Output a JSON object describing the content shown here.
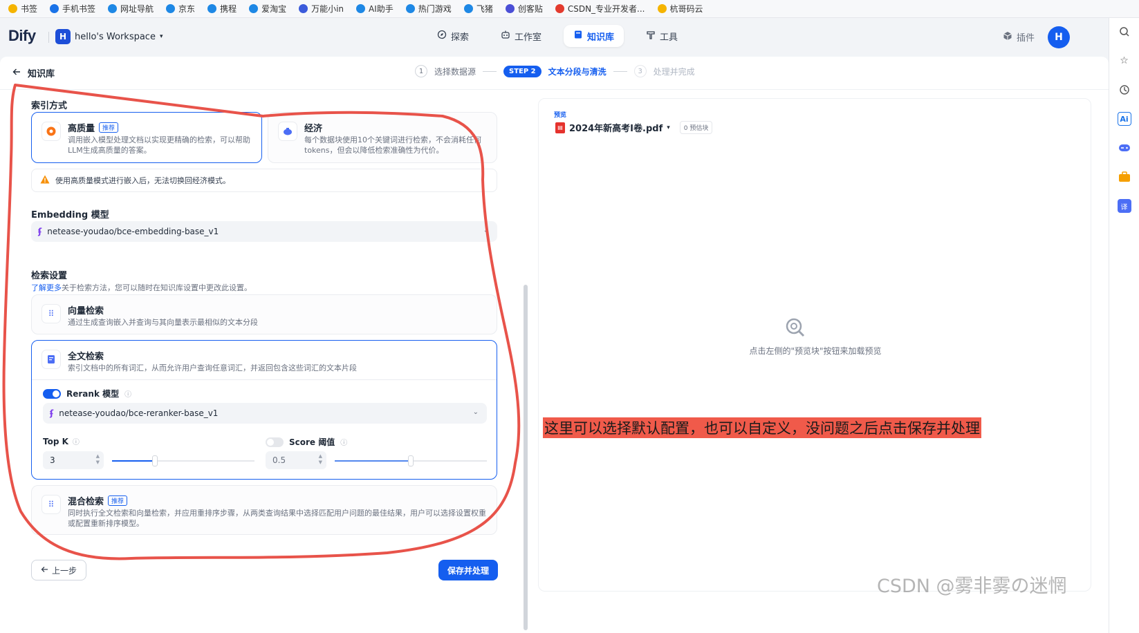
{
  "bookmarks": [
    {
      "label": "书签",
      "color": "#f5b400"
    },
    {
      "label": "手机书签",
      "color": "#1a73e8"
    },
    {
      "label": "网址导航",
      "color": "#1e88e5"
    },
    {
      "label": "京东",
      "color": "#1e88e5"
    },
    {
      "label": "携程",
      "color": "#1e88e5"
    },
    {
      "label": "爱淘宝",
      "color": "#1e88e5"
    },
    {
      "label": "万能小in",
      "color": "#3b5bdb"
    },
    {
      "label": "AI助手",
      "color": "#1e88e5"
    },
    {
      "label": "热门游戏",
      "color": "#1e88e5"
    },
    {
      "label": "飞猪",
      "color": "#1e88e5"
    },
    {
      "label": "创客贴",
      "color": "#4b4fd6"
    },
    {
      "label": "CSDN_专业开发者...",
      "color": "#e33b2e"
    },
    {
      "label": "杭哥码云",
      "color": "#f5b400"
    }
  ],
  "header": {
    "logo": "Dify",
    "workspace_initial": "H",
    "workspace_name": "hello's Workspace",
    "nav": [
      "探索",
      "工作室",
      "知识库",
      "工具"
    ],
    "plugin": "插件",
    "user_initial": "H"
  },
  "topbar": {
    "back_label": "知识库",
    "steps": {
      "s1_num": "1",
      "s1_label": "选择数据源",
      "s2_badge": "STEP 2",
      "s2_label": "文本分段与清洗",
      "s3_num": "3",
      "s3_label": "处理并完成"
    }
  },
  "index": {
    "title": "索引方式",
    "high": {
      "title": "高质量",
      "tag": "推荐",
      "desc1": "调用嵌入模型处理文档以实现更精确的检索，可以帮助",
      "desc2": "LLM生成高质量的答案。"
    },
    "eco": {
      "title": "经济",
      "desc1": "每个数据块使用10个关键词进行检索，不会消耗任何",
      "desc2": "tokens，但会以降低检索准确性为代价。"
    },
    "warning": "使用高质量模式进行嵌入后，无法切换回经济模式。"
  },
  "embedding": {
    "title": "Embedding 模型",
    "value": "netease-youdao/bce-embedding-base_v1"
  },
  "retrieval": {
    "title": "检索设置",
    "learn_link": "了解更多",
    "learn_rest": "关于检索方法，您可以随时在知识库设置中更改此设置。",
    "vector": {
      "title": "向量检索",
      "desc": "通过生成查询嵌入并查询与其向量表示最相似的文本分段"
    },
    "fulltext": {
      "title": "全文检索",
      "desc": "索引文档中的所有词汇，从而允许用户查询任意词汇，并返回包含这些词汇的文本片段"
    },
    "rerank_label": "Rerank 模型",
    "rerank_value": "netease-youdao/bce-reranker-base_v1",
    "topk_label": "Top K",
    "topk_value": "3",
    "score_label": "Score 阈值",
    "score_value": "0.5",
    "hybrid": {
      "title": "混合检索",
      "tag": "推荐",
      "desc1": "同时执行全文检索和向量检索，并应用重排序步骤，从两类查询结果中选择匹配用户问题的最佳结果，用户可以选择设置权重",
      "desc2": "或配置重新排序模型。"
    }
  },
  "controls": {
    "topk_level": 0.3,
    "score_level": 0.5
  },
  "buttons": {
    "prev": "上一步",
    "save": "保存并处理"
  },
  "preview": {
    "label": "预览",
    "file": "2024年新高考I卷.pdf",
    "chip": "0 预估块",
    "empty": "点击左侧的\"预览块\"按钮来加载预览"
  },
  "annotation": "这里可以选择默认配置，也可以自定义，没问题之后点击保存并处理",
  "watermark": "CSDN @雾非雾の迷惘",
  "colors": {
    "accent": "#155eef",
    "annotation_bg": "#f05a4a",
    "scribble": "#e8534a"
  }
}
